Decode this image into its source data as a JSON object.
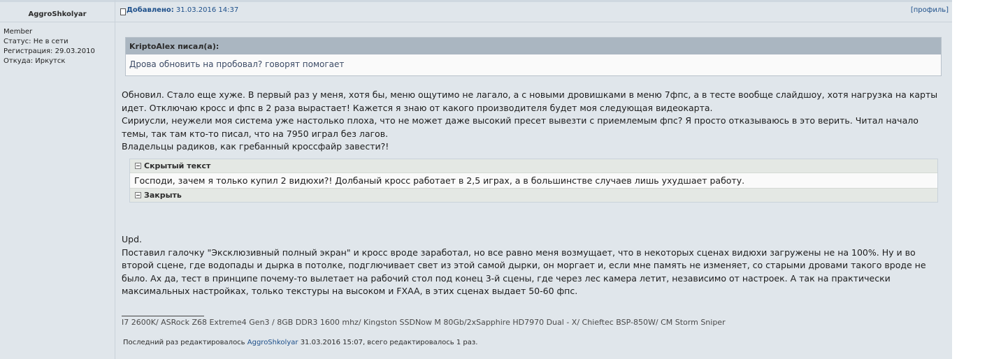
{
  "author": {
    "name": "AggroShkolyar",
    "rank": "Member",
    "status": "Статус: Не в сети",
    "registered": "Регистрация: 29.03.2010",
    "location": "Откуда: Иркутск"
  },
  "header": {
    "added_label": "Добавлено:",
    "added_date": "31.03.2016 14:37",
    "profile_link": "[профиль]"
  },
  "quote": {
    "author_line": "KriptoAlex писал(а):",
    "text": "Дрова обновить на пробовал? говорят помогает"
  },
  "body": {
    "lines": [
      "Обновил. Стало еще хуже. В первый раз у меня, хотя бы, меню ощутимо не лагало, а с новыми дровишками в меню 7фпс, а в тесте вообще слайдшоу, хотя нагрузка на карты идет. Отключаю кросс и фпс в 2 раза вырастает! Кажется я знаю от какого производителя будет моя следующая видеокарта.",
      "Сириусли, неужели моя система уже настолько плоха, что не может даже высокий пресет вывезти с приемлемым фпс? Я просто отказываюсь в это верить. Читал начало темы, так там кто-то писал, что на 7950 играл без лагов.",
      "Владельцы радиков, как гребанный кроссфайр завести?!"
    ]
  },
  "spoiler": {
    "title": "Скрытый текст",
    "text": "Господи, зачем я только купил 2 видюхи?! Долбаный кросс работает в 2,5 играх, а в большинстве случаев лишь ухудшает работу.",
    "close_label": "Закрыть"
  },
  "update": {
    "label": "Upd.",
    "text": "Поставил галочку \"Эксклюзивный полный экран\" и кросс вроде заработал, но все равно меня возмущает, что в некоторых сценах видюхи загружены не на 100%. Ну и во второй сцене, где водопады и дырка в потолке, подглючивает свет из этой самой дырки, он моргает и, если мне память не изменяет, со старыми дровами такого вроде не было. Ах да, тест в принципе почему-то вылетает на рабочий стол под конец 3-й сцены, где через лес камера летит, независимо от настроек. А так на практически максимальных настройках, только текстуры на высоком и FXAA, в этих сценах выдает 50-60 фпс."
  },
  "signature": "I7 2600K/ ASRock Z68 Extreme4 Gen3 / 8GB DDR3 1600 mhz/ Kingston SSDNow M 80Gb/2xSapphire HD7970 Dual - X/ Chieftec BSP-850W/ CM Storm Sniper",
  "edit_note": {
    "prefix": "Последний раз редактировалось",
    "user": "AggroShkolyar",
    "suffix": "31.03.2016 15:07, всего редактировалось 1 раз."
  }
}
